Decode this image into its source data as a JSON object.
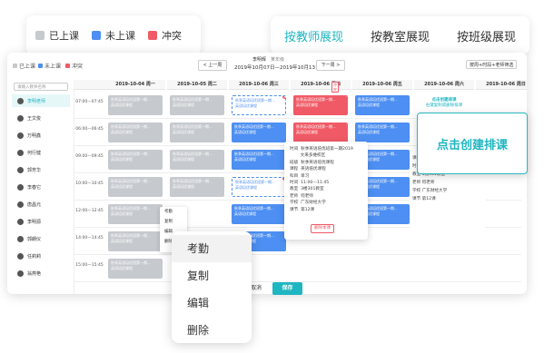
{
  "legend": {
    "items": [
      {
        "label": "已上课",
        "color": "#c6c9ce"
      },
      {
        "label": "未上课",
        "color": "#4d8ff2"
      },
      {
        "label": "冲突",
        "color": "#f05a66"
      }
    ]
  },
  "view_tabs": [
    {
      "label": "按教师展现",
      "active": true
    },
    {
      "label": "按教室展现",
      "active": false
    },
    {
      "label": "按班级展现",
      "active": false
    }
  ],
  "toolbar": {
    "mini_legend": [
      "已上课",
      "未上课",
      "冲突"
    ],
    "prev_week": "< 上一周",
    "next_week": "下一周 >",
    "teacher": "李明辉",
    "teacher_tag": "某年级",
    "date_range": "2019年10月07日—2019年10月13日",
    "filter": "按周+时段+老师筛选"
  },
  "sidebar": {
    "search_placeholder": "请输入教师名称",
    "teachers": [
      "李明老师",
      "王文俊",
      "万明鑫",
      "何行健",
      "郭芳华",
      "李春它",
      "唐昌元",
      "李明源",
      "郭朗仪",
      "任莉莉",
      "翁燕艳"
    ]
  },
  "grid": {
    "days": [
      "2019-10-04 周一",
      "2019-10-05 周二",
      "2019-10-06 周三",
      "2019-10-06 周四",
      "2019-10-06 周五",
      "2019-10-06 周六",
      "2019-10-06 周日"
    ],
    "conflict_tag": "冲突",
    "times": [
      "07:00—07:45",
      "06:00—06:45",
      "09:00—09:45",
      "10:00—10:45",
      "12:00—12:45",
      "14:00—14:45",
      "15:00—15:45"
    ],
    "event_line1": "秋季英语培优班第一期...",
    "event_line2": "英语培优课程",
    "create_hint": "点击创建排课",
    "create_hint_sub": "右键复制或删除排课"
  },
  "popup": {
    "lines": [
      "时间  秋季英语培优班第一期2019",
      "        文来多维校区",
      "班级  秋季英语培优课程",
      "课程  英语培优课程",
      "科目  单习",
      "时间  11:00—11:45",
      "教室  3楼301教室",
      "老师  何老师",
      "学校  广东财经大学",
      "课节  第12课"
    ],
    "delete_button": "删除本课"
  },
  "detail_right": {
    "lines": [
      "课程  单习",
      "时间  11:00—11:00",
      "教室  3楼301教室",
      "老师  何老师",
      "学校  广东财经大学",
      "课节  第12课"
    ]
  },
  "create_card": {
    "label": "点击创建排课"
  },
  "mini_menu": [
    "考勤",
    "复制",
    "编辑",
    "删除"
  ],
  "context_menu": [
    "考勤",
    "复制",
    "编辑",
    "删除"
  ],
  "footer": {
    "cancel": "取消",
    "save": "保存"
  }
}
